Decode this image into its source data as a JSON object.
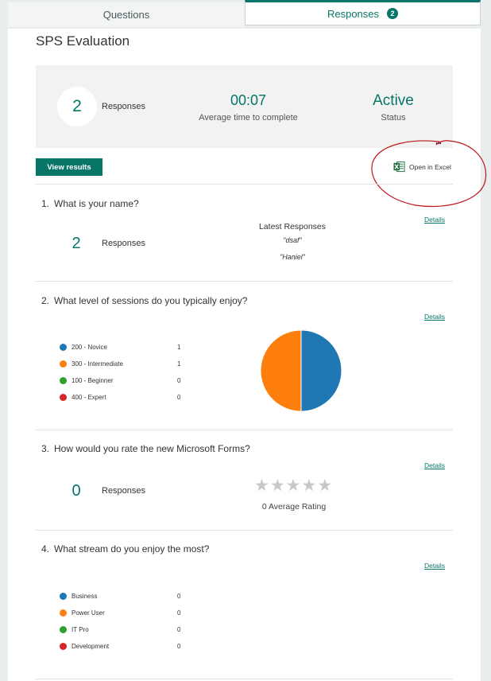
{
  "tabs": {
    "questions_label": "Questions",
    "responses_label": "Responses",
    "responses_badge": "2"
  },
  "form": {
    "title": "SPS Evaluation"
  },
  "summary": {
    "responses_count": "2",
    "responses_label": "Responses",
    "avg_time": "00:07",
    "avg_time_label": "Average time to complete",
    "status": "Active",
    "status_label": "Status",
    "more_label": "..."
  },
  "actions": {
    "view_results": "View results",
    "open_in_excel": "Open in Excel"
  },
  "questions": [
    {
      "number": "1.",
      "title": "What is your name?",
      "details_label": "Details",
      "count": "2",
      "count_label": "Responses",
      "latest_label": "Latest Responses",
      "latest": [
        "\"dsaf\"",
        "\"Haniel\""
      ]
    },
    {
      "number": "2.",
      "title": "What level of sessions do you typically enjoy?",
      "details_label": "Details",
      "options": [
        {
          "label": "200 - Novice",
          "value": 1,
          "color": "#1f78b4"
        },
        {
          "label": "300 - Intermediate",
          "value": 1,
          "color": "#ff7f0e"
        },
        {
          "label": "100 - Beginner",
          "value": 0,
          "color": "#2ca02c"
        },
        {
          "label": "400 - Expert",
          "value": 0,
          "color": "#d62728"
        }
      ]
    },
    {
      "number": "3.",
      "title": "How would you rate the new Microsoft Forms?",
      "details_label": "Details",
      "count": "0",
      "count_label": "Responses",
      "average_rating": "0 Average Rating",
      "rating_value": 0,
      "rating_max": 5
    },
    {
      "number": "4.",
      "title": "What stream do you enjoy the most?",
      "details_label": "Details",
      "options": [
        {
          "label": "Business",
          "value": 0,
          "color": "#1f78b4"
        },
        {
          "label": "Power User",
          "value": 0,
          "color": "#ff7f0e"
        },
        {
          "label": "IT Pro",
          "value": 0,
          "color": "#2ca02c"
        },
        {
          "label": "Development",
          "value": 0,
          "color": "#d62728"
        }
      ]
    }
  ],
  "colors": {
    "accent": "#077568",
    "annotation": "#c0161b"
  }
}
